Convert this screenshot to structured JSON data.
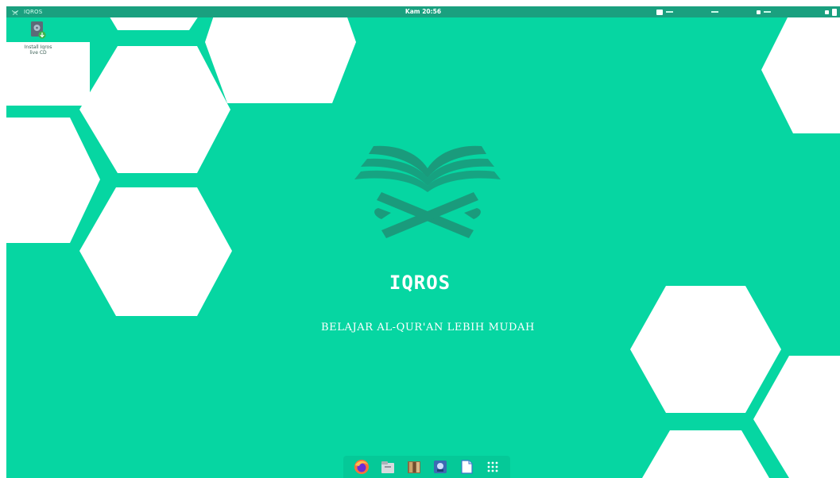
{
  "topbar": {
    "app_name": "IQROS",
    "clock": "Kam 20:56"
  },
  "desktop_icon": {
    "label": "Install Iqros live CD"
  },
  "wallpaper": {
    "title": "IQROS",
    "subtitle": "BELAJAR AL-QUR'AN LEBIH MUDAH",
    "colors": {
      "background": "#06d6a2",
      "hexagon": "#ffffff",
      "logo": "#1a9b7c"
    }
  },
  "dock": {
    "items": [
      {
        "name": "firefox-icon"
      },
      {
        "name": "files-icon"
      },
      {
        "name": "quran-app-icon"
      },
      {
        "name": "installer-icon"
      },
      {
        "name": "text-document-icon"
      },
      {
        "name": "app-grid-icon"
      }
    ]
  }
}
